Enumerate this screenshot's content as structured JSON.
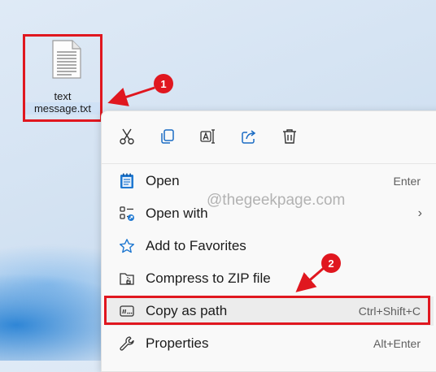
{
  "desktop": {
    "file": {
      "name_line1": "text",
      "name_line2": "message.txt"
    }
  },
  "annotations": {
    "step1": "1",
    "step2": "2",
    "accent": "#e0171f"
  },
  "watermark": "@thegeekpage.com",
  "context_menu": {
    "toolbar": [
      {
        "icon": "cut-icon"
      },
      {
        "icon": "copy-icon"
      },
      {
        "icon": "rename-icon"
      },
      {
        "icon": "share-icon"
      },
      {
        "icon": "delete-icon"
      }
    ],
    "items": [
      {
        "icon": "notepad-icon",
        "label": "Open",
        "shortcut": "Enter"
      },
      {
        "icon": "open-with-icon",
        "label": "Open with",
        "submenu": true
      },
      {
        "icon": "star-icon",
        "label": "Add to Favorites"
      },
      {
        "icon": "zip-folder-icon",
        "label": "Compress to ZIP file"
      },
      {
        "icon": "copy-path-icon",
        "label": "Copy as path",
        "shortcut": "Ctrl+Shift+C"
      },
      {
        "icon": "wrench-icon",
        "label": "Properties",
        "shortcut": "Alt+Enter"
      }
    ]
  }
}
